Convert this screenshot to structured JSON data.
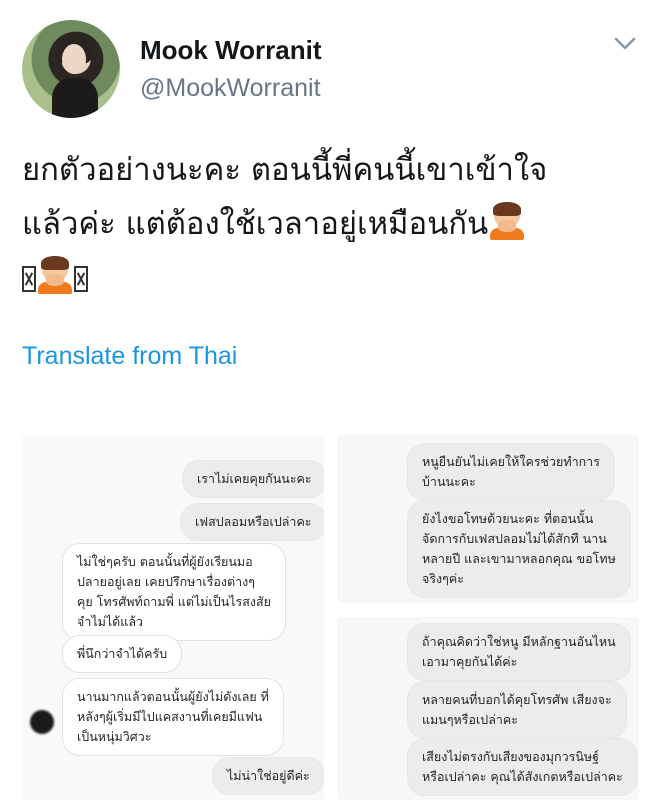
{
  "tweet": {
    "author_name": "Mook Worranit",
    "author_handle": "@MookWorranit",
    "text_line1": "ยกตัวอย่างนะคะ ตอนนี้พี่คนนี้เขาเข้าใจ",
    "text_line2": "แล้วค่ะ แต่ต้องใช้เวลาอยู่เหมือนกัน",
    "translate_label": "Translate from Thai",
    "icons": [
      "chevron-down-icon",
      "person-bowing-emoji",
      "missing-glyph"
    ]
  },
  "screenshots": {
    "left": [
      {
        "side": "out",
        "lines": [
          "เราไม่เคยคุยกันนะคะ"
        ]
      },
      {
        "side": "out",
        "lines": [
          "เฟสปลอมหรือเปล่าคะ"
        ]
      },
      {
        "side": "in",
        "lines": [
          "ไม่ใช่ๆครับ ตอนนั้นที่ผู้ยังเรียนมอ",
          "ปลายอยู่เลย เคยปรึกษาเรื่องต่างๆ",
          "คุย โทรศัพท์ถามพี่ แต่ไม่เป็นไรสงสัย",
          "จำไม่ได้แล้ว"
        ]
      },
      {
        "side": "in",
        "lines": [
          "พี่นึกว่าจำได้ครับ"
        ]
      },
      {
        "side": "in",
        "lines": [
          "นานมากแล้วตอนนั้นผู้ยังไม่ดังเลย ที่",
          "หลังๆผู้เริ่มมีไปแคสงานที่เคยมีแฟน",
          "เป็นหนุ่มวิศวะ"
        ]
      },
      {
        "side": "out",
        "lines": [
          "ไม่น่าใช่อยู่ดีค่ะ"
        ]
      }
    ],
    "right_top": [
      {
        "side": "out",
        "lines": [
          "หนูยืนยันไม่เคยให้ใครช่วยทำการ",
          "บ้านนะคะ"
        ]
      },
      {
        "side": "out",
        "lines": [
          "ยังไงขอโทษด้วยนะคะ ที่ตอนนั้น",
          "จัดการกับเฟสปลอมไม่ได้สักที นาน",
          "หลายปี และเขามาหลอกคุณ ขอโทษ",
          "จริงๆค่ะ"
        ]
      }
    ],
    "right_bottom": [
      {
        "side": "out",
        "lines": [
          "ถ้าคุณคิดว่าใช่หนู มีหลักฐานอันไหน",
          "เอามาคุยกันได้ค่ะ"
        ]
      },
      {
        "side": "out",
        "lines": [
          "หลายคนที่บอกได้คุยโทรศัพ เสียงจะ",
          "แมนๆหรือเปล่าคะ"
        ]
      },
      {
        "side": "out",
        "lines": [
          "เสียงไม่ตรงกับเสียงของมุกวรนิษฐ์",
          "หรือเปล่าคะ คุณได้สังเกตหรือเปล่าคะ"
        ]
      }
    ]
  }
}
